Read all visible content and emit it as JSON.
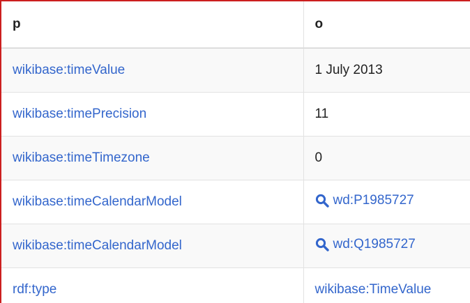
{
  "table": {
    "headers": {
      "p": "p",
      "o": "o"
    },
    "rows": [
      {
        "p": "wikibase:timeValue",
        "o": "1 July 2013",
        "o_type": "literal"
      },
      {
        "p": "wikibase:timePrecision",
        "o": "11",
        "o_type": "literal"
      },
      {
        "p": "wikibase:timeTimezone",
        "o": "0",
        "o_type": "literal"
      },
      {
        "p": "wikibase:timeCalendarModel",
        "o": "wd:P1985727",
        "o_type": "entity",
        "o_icon": "search-icon"
      },
      {
        "p": "wikibase:timeCalendarModel",
        "o": "wd:Q1985727",
        "o_type": "entity",
        "o_icon": "search-icon"
      },
      {
        "p": "rdf:type",
        "o": "wikibase:TimeValue",
        "o_type": "link"
      }
    ]
  },
  "colors": {
    "link": "#3366cc",
    "text": "#222222",
    "frame_border": "#cc1f1f",
    "row_stripe": "#f9f9f9"
  }
}
